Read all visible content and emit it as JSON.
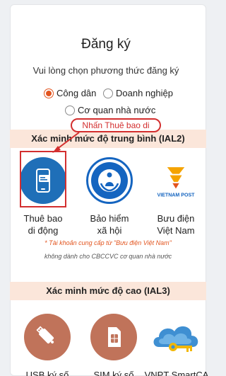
{
  "title": "Đăng ký",
  "subtitle": "Vui lòng chọn phương thức đăng ký",
  "subject_options": [
    {
      "label": "Công dân",
      "checked": true
    },
    {
      "label": "Doanh nghiệp",
      "checked": false
    },
    {
      "label": "Cơ quan nhà nước",
      "checked": false
    }
  ],
  "section_ial2": "Xác minh mức độ trung bình (IAL2)",
  "callout": "Nhấn Thuê bao di",
  "ial2_methods": [
    {
      "line1": "Thuê bao",
      "line2": "di động",
      "icon": "mobile-subscription-icon"
    },
    {
      "line1": "Bảo hiểm",
      "line2": "xã hội",
      "icon": "social-insurance-logo-icon"
    },
    {
      "line1": "Bưu điện",
      "line2": "Việt Nam",
      "icon": "vietnam-post-logo-icon"
    }
  ],
  "vietnam_post_logo_text": "VIETNAM POST",
  "note_line1": "* Tài khoản cung cấp từ \"Bưu điện Việt Nam\"",
  "note_line2": "không dành cho CBCCVC cơ quan nhà nước",
  "section_ial3": "Xác minh mức độ cao (IAL3)",
  "ial3_methods": [
    {
      "label": "USB ký số",
      "icon": "usb-token-icon"
    },
    {
      "label": "SIM ký số",
      "icon": "sim-card-icon"
    },
    {
      "label": "VNPT SmartCA",
      "icon": "cloud-key-icon"
    }
  ],
  "colors": {
    "accent": "#e2541e",
    "section_bg": "#fbe6da",
    "callout_red": "#d32f2f",
    "mobile_blue": "#1f6fb8",
    "ial3_brown": "#c0735a"
  }
}
